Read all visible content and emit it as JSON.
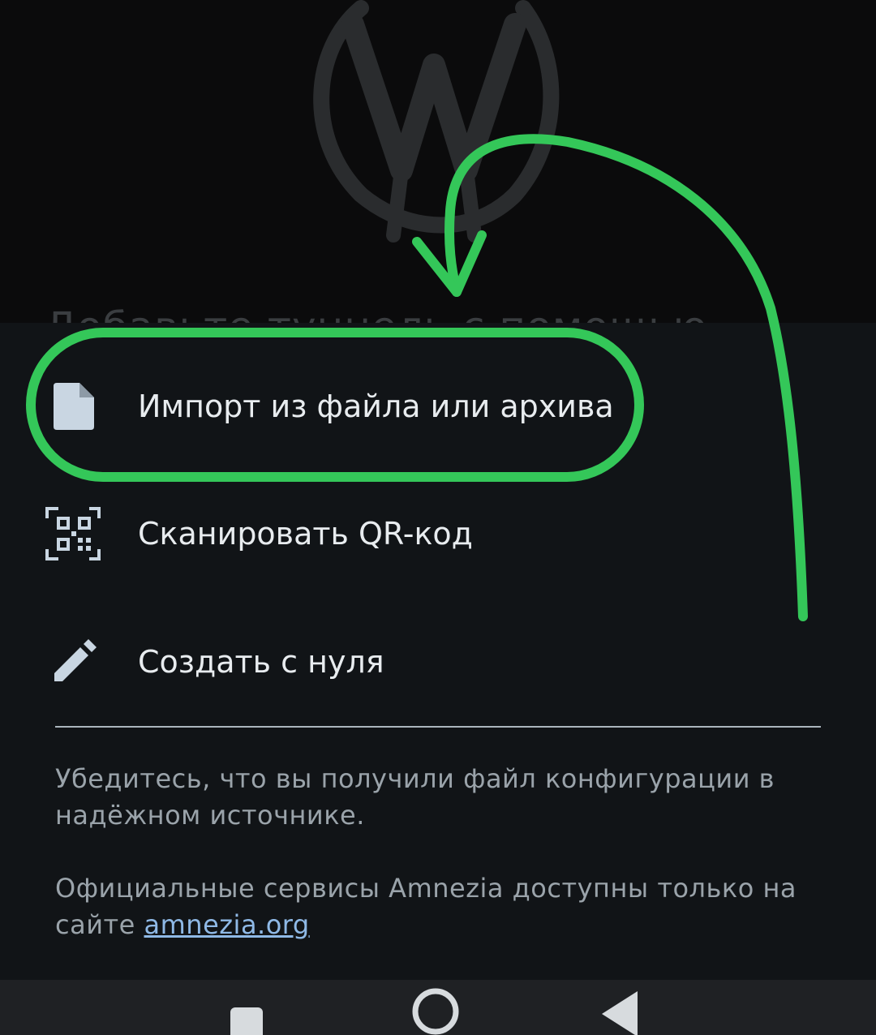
{
  "background": {
    "obscured_text": "Добавьте туннель с помощью"
  },
  "sheet": {
    "items": [
      {
        "label": "Импорт из файла или архива",
        "icon": "file-icon"
      },
      {
        "label": "Сканировать QR-код",
        "icon": "qr-code-icon"
      },
      {
        "label": "Создать с нуля",
        "icon": "pencil-icon"
      }
    ],
    "info": {
      "warning": "Убедитесь, что вы получили файл конфигурации в надёжном источнике.",
      "official_prefix": "Официальные сервисы Amnezia доступны только на сайте ",
      "official_link": "amnezia.org"
    }
  },
  "navbar": {
    "buttons": [
      "recents-button",
      "home-button",
      "back-button"
    ]
  },
  "colors": {
    "sheet_bg": "#111417",
    "text": "#e8ecef",
    "muted_text": "#9aa3aa",
    "link": "#8fb9e6",
    "annotation": "#34c759"
  }
}
